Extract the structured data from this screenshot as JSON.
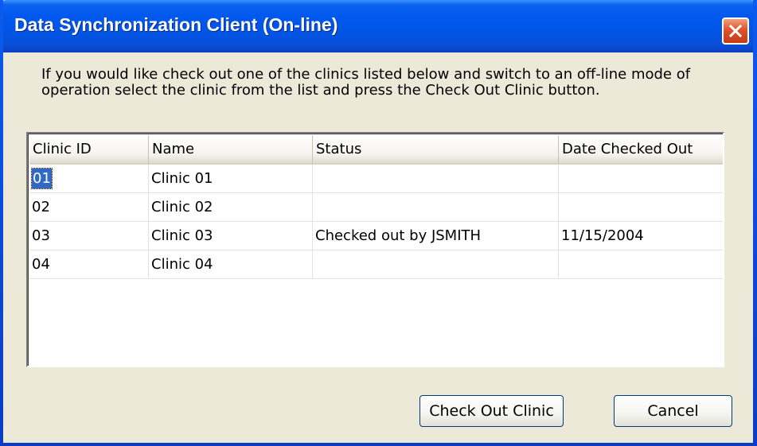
{
  "window": {
    "title": "Data Synchronization Client (On-line)",
    "close_icon": "close-icon"
  },
  "instructions": "If you would like check out one of the clinics listed below and switch to an off-line mode of operation select the clinic from the list and press the Check Out Clinic button.",
  "table": {
    "columns": [
      "Clinic ID",
      "Name",
      "Status",
      "Date Checked Out"
    ],
    "rows": [
      [
        "01",
        "Clinic 01",
        "",
        ""
      ],
      [
        "02",
        "Clinic 02",
        "",
        ""
      ],
      [
        "03",
        "Clinic 03",
        "Checked out by JSMITH",
        "11/15/2004"
      ],
      [
        "04",
        "Clinic 04",
        "",
        ""
      ]
    ],
    "selected_row": 0
  },
  "buttons": {
    "check_out": "Check Out Clinic",
    "cancel": "Cancel"
  },
  "colors": {
    "titlebar": "#0055e5",
    "window_bg": "#ece9d8",
    "selection": "#316ac5",
    "close_button": "#e0522a"
  }
}
